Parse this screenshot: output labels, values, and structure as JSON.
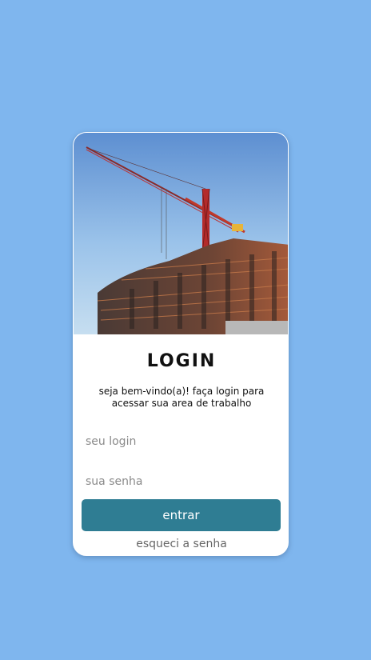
{
  "page": {
    "background_color": "#7fb6ee"
  },
  "card": {
    "hero_image": "construction-crane-building-image",
    "title": "LOGIN",
    "subtitle": "seja bem-vindo(a)! faça login para acessar sua area de trabalho",
    "login_placeholder": "seu login",
    "login_value": "",
    "password_placeholder": "sua senha",
    "password_value": "",
    "submit_label": "entrar",
    "submit_color": "#2f7d93",
    "forgot_label": "esqueci a senha"
  }
}
